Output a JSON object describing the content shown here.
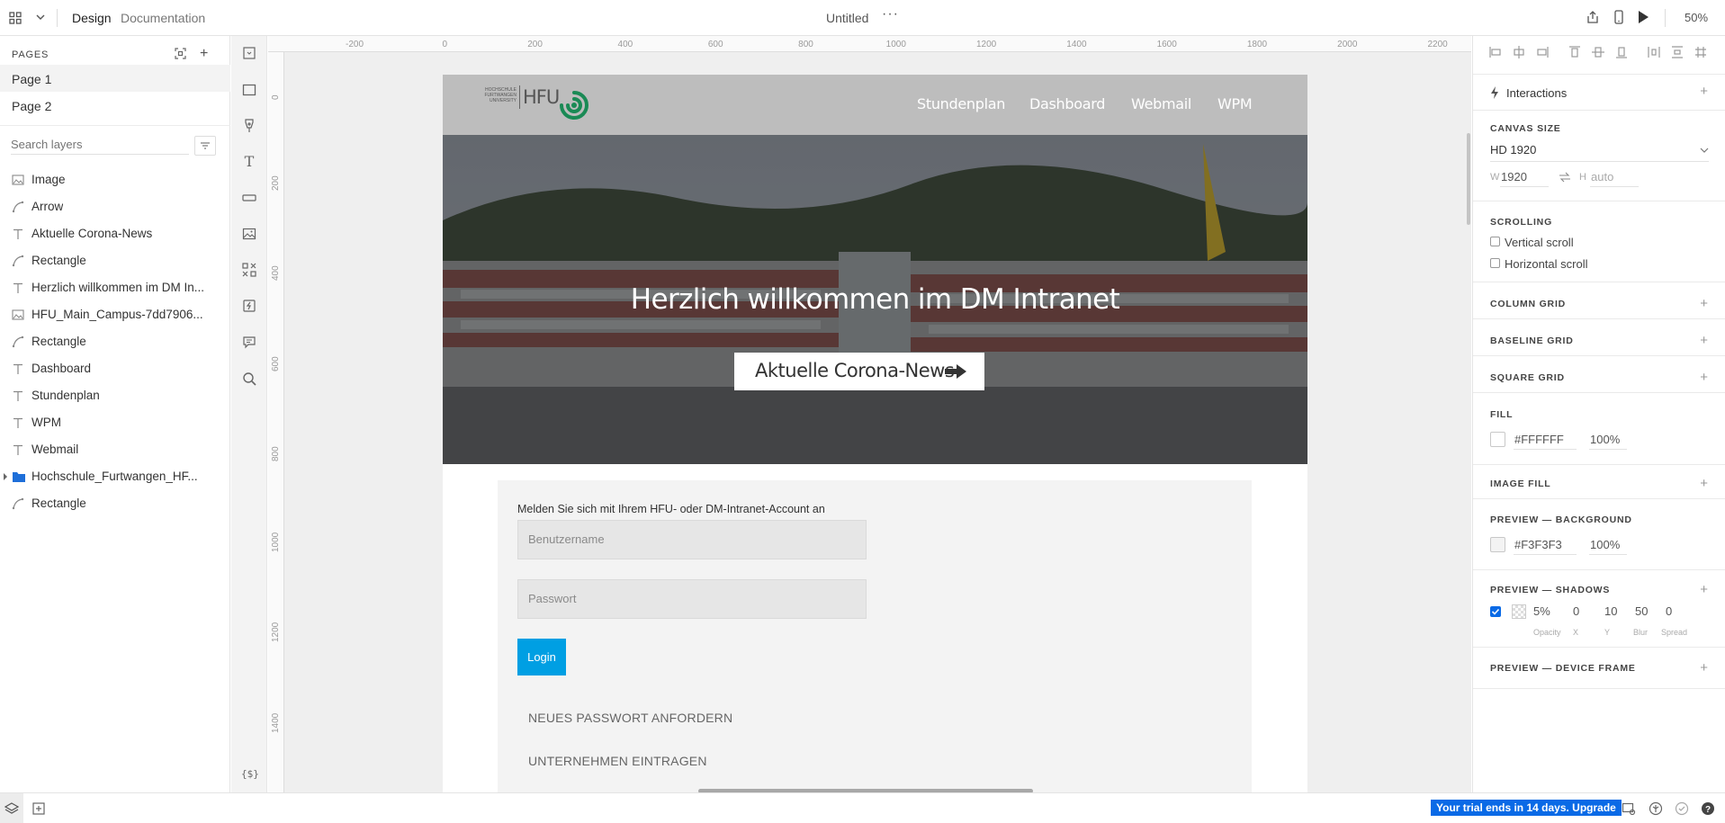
{
  "app": {
    "tabs": [
      "Design",
      "Documentation"
    ],
    "document_title": "Untitled",
    "zoom": "50%"
  },
  "pages": {
    "header": "PAGES",
    "items": [
      "Page 1",
      "Page 2"
    ],
    "selected": "Page 1"
  },
  "layers": {
    "search_placeholder": "Search layers",
    "items": [
      {
        "label": "Image",
        "type": "image"
      },
      {
        "label": "Arrow",
        "type": "path"
      },
      {
        "label": "Aktuelle Corona-News",
        "type": "text"
      },
      {
        "label": "Rectangle",
        "type": "path"
      },
      {
        "label": "Herzlich willkommen im DM In...",
        "type": "text"
      },
      {
        "label": "HFU_Main_Campus-7dd7906...",
        "type": "image"
      },
      {
        "label": "Rectangle",
        "type": "path"
      },
      {
        "label": "Dashboard",
        "type": "text"
      },
      {
        "label": "Stundenplan",
        "type": "text"
      },
      {
        "label": "WPM",
        "type": "text"
      },
      {
        "label": "Webmail",
        "type": "text"
      },
      {
        "label": "Hochschule_Furtwangen_HF...",
        "type": "group"
      },
      {
        "label": "Rectangle",
        "type": "path"
      }
    ]
  },
  "rulers": {
    "horizontal": [
      "-200",
      "0",
      "200",
      "400",
      "600",
      "800",
      "1000",
      "1200",
      "1400",
      "1600",
      "1800",
      "2000",
      "2200"
    ],
    "vertical": [
      "0",
      "200",
      "400",
      "600",
      "800",
      "1000",
      "1200",
      "1400"
    ]
  },
  "artboard": {
    "logo": {
      "small_text": [
        "HOCHSCHULE",
        "FURTWANGEN",
        "UNIVERSITY"
      ],
      "mark": "HFU"
    },
    "nav": [
      "Stundenplan",
      "Dashboard",
      "Webmail",
      "WPM"
    ],
    "hero_title": "Herzlich willkommen im DM Intranet",
    "hero_button": "Aktuelle Corona-News",
    "login": {
      "prompt": "Melden Sie sich mit Ihrem HFU- oder DM-Intranet-Account an",
      "username_placeholder": "Benutzername",
      "password_placeholder": "Passwort",
      "login_button": "Login",
      "forgot_password": "NEUES PASSWORT ANFORDERN",
      "register_company": "UNTERNEHMEN EINTRAGEN"
    }
  },
  "inspector": {
    "interactions": "Interactions",
    "canvas_size": {
      "header": "CANVAS SIZE",
      "preset": "HD 1920",
      "w_label": "W",
      "w_value": "1920",
      "h_label": "H",
      "h_value": "auto"
    },
    "scrolling": {
      "header": "SCROLLING",
      "vertical": "Vertical scroll",
      "horizontal": "Horizontal scroll",
      "vertical_checked": false,
      "horizontal_checked": false
    },
    "column_grid": "COLUMN GRID",
    "baseline_grid": "BASELINE GRID",
    "square_grid": "SQUARE GRID",
    "fill": {
      "header": "FILL",
      "color": "#FFFFFF",
      "opacity": "100%"
    },
    "image_fill": "IMAGE FILL",
    "preview_background": {
      "header": "PREVIEW — BACKGROUND",
      "color": "#F3F3F3",
      "opacity": "100%"
    },
    "preview_shadows": {
      "header": "PREVIEW — SHADOWS",
      "enabled": true,
      "values": [
        "5%",
        "0",
        "10",
        "50",
        "0"
      ],
      "labels": [
        "Opacity",
        "X",
        "Y",
        "Blur",
        "Spread"
      ]
    },
    "preview_device_frame": "PREVIEW — DEVICE FRAME"
  },
  "status": {
    "trial": "Your trial ends in 14 days. Upgrade"
  },
  "colors": {
    "accent": "#0a6ae6",
    "login_button": "#009fe3",
    "hfu_green": "#1a8a55",
    "header_gray": "#bdbdbd"
  }
}
